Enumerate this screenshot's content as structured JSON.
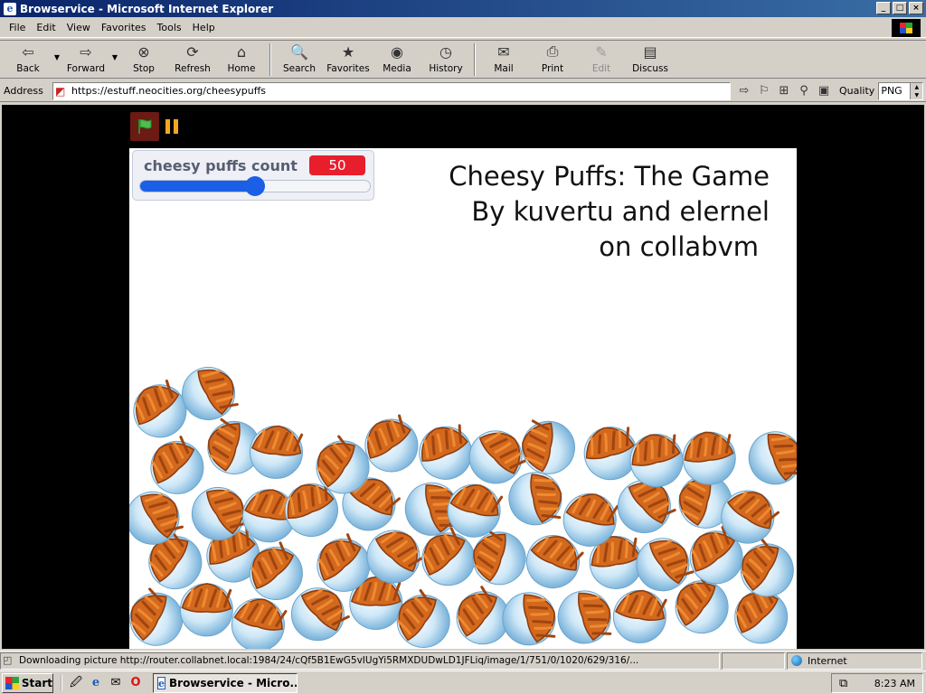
{
  "window": {
    "title": "Browservice - Microsoft Internet Explorer",
    "buttons": {
      "minimize": "_",
      "maximize": "□",
      "close": "×"
    }
  },
  "menu": [
    "File",
    "Edit",
    "View",
    "Favorites",
    "Tools",
    "Help"
  ],
  "toolbar": {
    "back": "Back",
    "forward": "Forward",
    "stop": "Stop",
    "refresh": "Refresh",
    "home": "Home",
    "search": "Search",
    "favorites": "Favorites",
    "media": "Media",
    "history": "History",
    "mail": "Mail",
    "print": "Print",
    "edit": "Edit",
    "discuss": "Discuss"
  },
  "address": {
    "label": "Address",
    "url": "https://estuff.neocities.org/cheesypuffs",
    "quality_label": "Quality",
    "quality_value": "PNG"
  },
  "game": {
    "variable_name": "cheesy puffs count",
    "variable_value": "50",
    "slider_fraction": 0.5,
    "title_lines": [
      "Cheesy Puffs: The Game",
      "By kuvertu and elernel",
      "on collabvm"
    ],
    "bowl_count": 50
  },
  "status": {
    "text": "Downloading picture http://router.collabnet.local:1984/24/cQf5B1EwG5vIUgYi5RMXDUDwLD1JFLiq/image/1/751/0/1020/629/316/...",
    "zone": "Internet"
  },
  "taskbar": {
    "start": "Start",
    "task": "Browservice - Micro...",
    "clock": "8:23 AM"
  },
  "colors": {
    "titlebar": "#0a246a",
    "variable_badge": "#e81e2c",
    "slider": "#1a5fe6",
    "flag_bg": "#6b1a14",
    "pause": "#f5a623"
  }
}
